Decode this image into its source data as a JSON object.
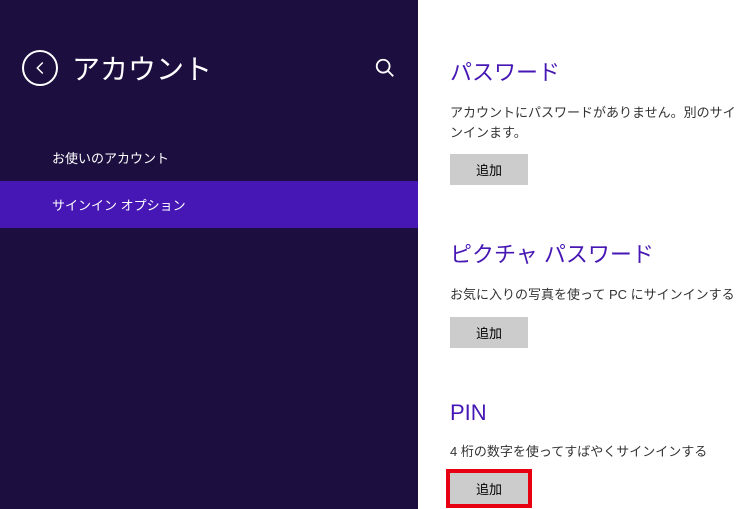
{
  "sidebar": {
    "title": "アカウント",
    "items": [
      {
        "label": "お使いのアカウント"
      },
      {
        "label": "サインイン オプション"
      }
    ]
  },
  "content": {
    "sections": [
      {
        "title": "パスワード",
        "desc": "アカウントにパスワードがありません。別のサインインます。",
        "button": "追加"
      },
      {
        "title": "ピクチャ パスワード",
        "desc": "お気に入りの写真を使って PC にサインインする",
        "button": "追加"
      },
      {
        "title": "PIN",
        "desc": "4 桁の数字を使ってすばやくサインインする",
        "button": "追加"
      }
    ]
  }
}
